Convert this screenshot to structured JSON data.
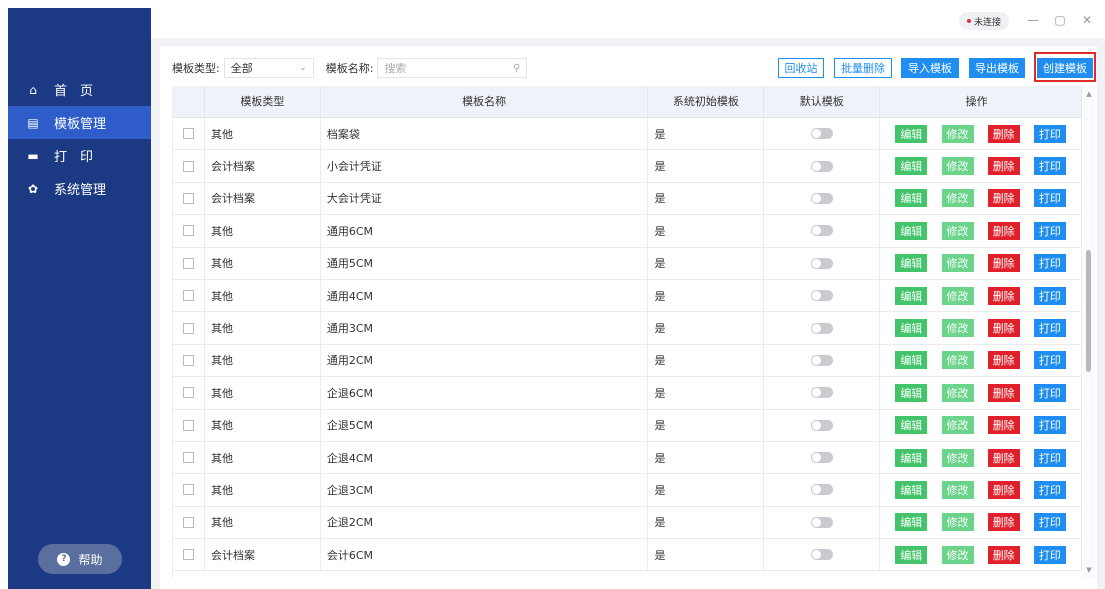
{
  "window": {
    "status": "未连接",
    "minimize": "—",
    "maximize": "▢",
    "close": "✕"
  },
  "sidebar": {
    "items": [
      {
        "label": "首　页",
        "icon": "home-icon",
        "glyph": "⌂"
      },
      {
        "label": "模板管理",
        "icon": "template-icon",
        "glyph": "▤"
      },
      {
        "label": "打　印",
        "icon": "printer-icon",
        "glyph": "▬"
      },
      {
        "label": "系统管理",
        "icon": "gear-icon",
        "glyph": "✿"
      }
    ],
    "help": "帮助",
    "help_icon": "?"
  },
  "toolbar": {
    "type_label": "模板类型:",
    "type_value": "全部",
    "name_label": "模板名称:",
    "search_placeholder": "搜索",
    "recycle": "回收站",
    "batch_delete": "批量删除",
    "import": "导入模板",
    "export": "导出模板",
    "create": "创建模板"
  },
  "table": {
    "headers": [
      "",
      "模板类型",
      "模板名称",
      "系统初始模板",
      "默认模板",
      "操作"
    ],
    "actions": {
      "edit": "编辑",
      "modify": "修改",
      "delete": "删除",
      "print": "打印"
    },
    "rows": [
      {
        "type": "其他",
        "name": "档案袋",
        "system": "是"
      },
      {
        "type": "会计档案",
        "name": "小会计凭证",
        "system": "是"
      },
      {
        "type": "会计档案",
        "name": "大会计凭证",
        "system": "是"
      },
      {
        "type": "其他",
        "name": "通用6CM",
        "system": "是"
      },
      {
        "type": "其他",
        "name": "通用5CM",
        "system": "是"
      },
      {
        "type": "其他",
        "name": "通用4CM",
        "system": "是"
      },
      {
        "type": "其他",
        "name": "通用3CM",
        "system": "是"
      },
      {
        "type": "其他",
        "name": "通用2CM",
        "system": "是"
      },
      {
        "type": "其他",
        "name": "企退6CM",
        "system": "是"
      },
      {
        "type": "其他",
        "name": "企退5CM",
        "system": "是"
      },
      {
        "type": "其他",
        "name": "企退4CM",
        "system": "是"
      },
      {
        "type": "其他",
        "name": "企退3CM",
        "system": "是"
      },
      {
        "type": "其他",
        "name": "企退2CM",
        "system": "是"
      },
      {
        "type": "会计档案",
        "name": "会计6CM",
        "system": "是"
      }
    ]
  },
  "colors": {
    "sidebar": "#1c3a84",
    "active": "#2e5cc9",
    "primary": "#1f8ef0",
    "green": "#43c46a",
    "red": "#e0202a"
  }
}
